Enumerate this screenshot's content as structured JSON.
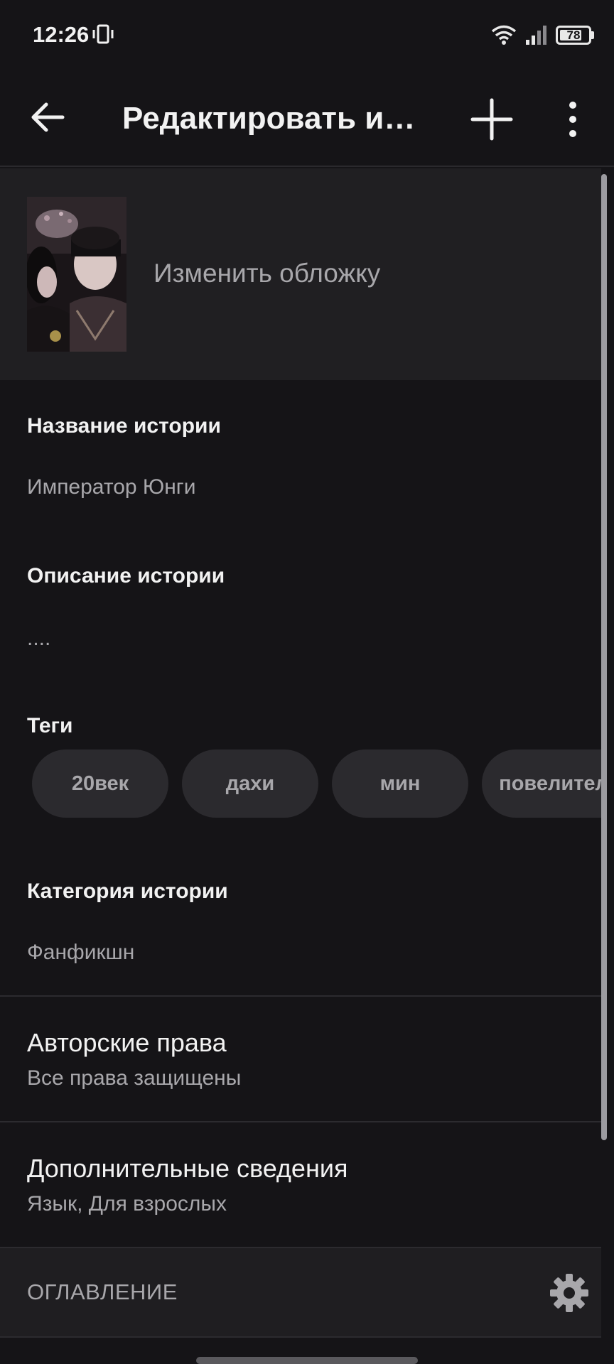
{
  "status_bar": {
    "time": "12:26",
    "battery_percent": 78,
    "battery_label": "78",
    "icons": [
      "vibrate-icon",
      "wifi-icon",
      "signal-icon",
      "battery-icon"
    ]
  },
  "app_bar": {
    "title": "Редактировать историю",
    "back_icon": "arrow-left-icon",
    "add_icon": "plus-icon",
    "more_icon": "more-vertical-icon"
  },
  "cover": {
    "change_label": "Изменить обложку"
  },
  "story": {
    "title_label": "Название истории",
    "title_value": "Император Юнги",
    "description_label": "Описание истории",
    "description_value": "....",
    "tags_label": "Теги",
    "tags": [
      "20век",
      "дахи",
      "мин",
      "повелитель"
    ],
    "category_label": "Категория истории",
    "category_value": "Фанфикшн"
  },
  "copyright": {
    "title": "Авторские права",
    "subtitle": "Все права защищены"
  },
  "extra_info": {
    "title": "Дополнительные сведения",
    "subtitle": "Язык, Для взрослых"
  },
  "toc": {
    "label": "ОГЛАВЛЕНИЕ",
    "settings_icon": "gear-icon"
  },
  "colors": {
    "background": "#151417",
    "surface": "#201f22",
    "chip": "#2b2a2e",
    "text_primary": "#f2f2f2",
    "text_secondary": "#a8a7ab"
  }
}
